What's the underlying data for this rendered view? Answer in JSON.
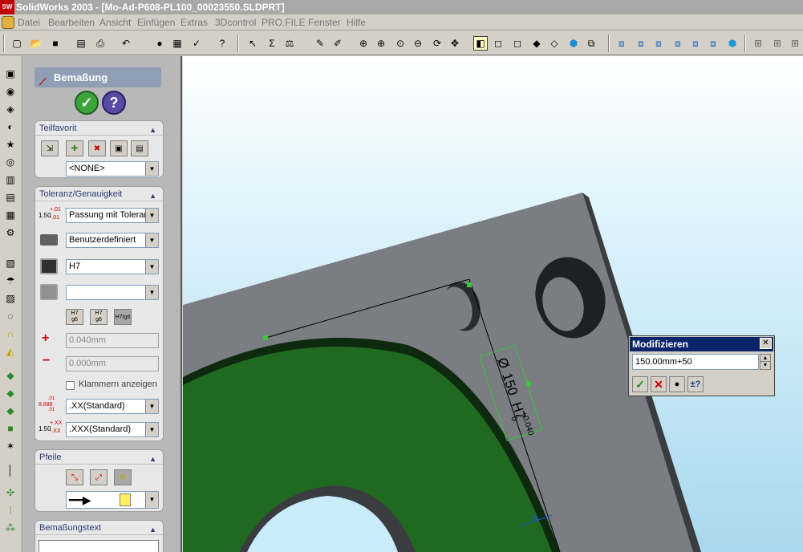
{
  "window": {
    "logo": "SW",
    "title": "SolidWorks 2003 - [Mo-Ad-P608-PL100_00023550.SLDPRT]"
  },
  "menu": [
    "Datei",
    "Bearbeiten",
    "Ansicht",
    "Einfügen",
    "Extras",
    "3Dcontrol",
    "PRO.FILE",
    "Fenster",
    "Hilfe"
  ],
  "panel": {
    "title": "Bemaßung",
    "ok_glyph": "✓",
    "help_glyph": "?",
    "favorites": {
      "label": "Teilfavorit",
      "combo": "<NONE>"
    },
    "tolerance": {
      "label": "Toleranz/Genauigkeit",
      "tol_type": "Passung mit Toleranz",
      "classification": "Benutzerdefiniert",
      "hole_fit": "H7",
      "shaft_fit": "",
      "plus_value": "0.040mm",
      "minus_value": "0.000mm",
      "show_brackets": "Klammern anzeigen",
      "primary_precision": ".XX(Standard)",
      "tol_precision": ".XXX(Standard)",
      "tol_icon_main": "1.50",
      "tol_icon_plus": "+.01",
      "tol_icon_minus": "-.01",
      "prec_icon_a": ".01",
      "prec_icon_b": "8.888",
      "prec_icon_c": ".01",
      "tolprec_icon_main": "1.50",
      "tolprec_icon_plus": "+.XX",
      "tolprec_icon_minus": "-.XX",
      "fit_btn_1a": "H7",
      "fit_btn_1b": "g6",
      "fit_btn_2a": "H7",
      "fit_btn_2b": "g6",
      "fit_btn_3": "H7/g6"
    },
    "arrows": {
      "label": "Pfeile"
    },
    "dimtext": {
      "label": "Bemaßungstext"
    }
  },
  "annotation": {
    "symbol": "Ø",
    "value": "150",
    "fit": "H7",
    "upper": "+0.040",
    "lower": "0"
  },
  "modify_dialog": {
    "title": "Modifizieren",
    "value": "150.00mm+50",
    "close": "✕",
    "rebuild": "±?"
  },
  "colors": {
    "face_green": "#1f6a1f",
    "plate_gray": "#7a7d82",
    "bg_top": "#ffffff",
    "bg_bottom": "#a8d8ee",
    "accent": "#0a246a"
  }
}
